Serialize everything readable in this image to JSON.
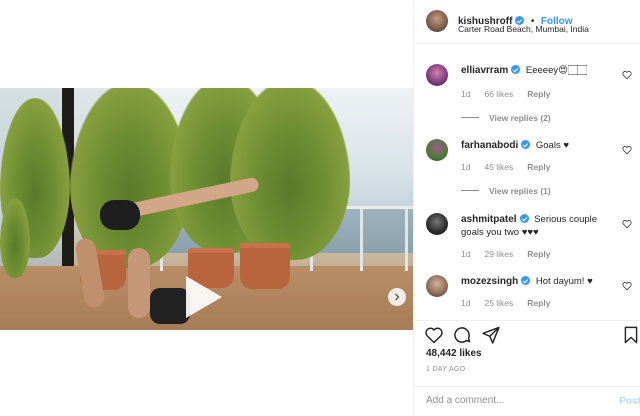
{
  "post": {
    "author": "kishushroff",
    "dot": "•",
    "follow_label": "Follow",
    "location": "Carter Road Beach, Mumbai, India",
    "likes": "48,442 likes",
    "timestamp": "1 DAY AGO",
    "add_comment_placeholder": "Add a comment...",
    "post_label": "Post"
  },
  "comments": [
    {
      "user": "elliavrram",
      "text": "Eeeeey😍🏻🏻",
      "age": "1d",
      "likes": "66 likes",
      "reply": "Reply",
      "view_replies": "View replies (2)"
    },
    {
      "user": "farhanabodi",
      "text": "Goals ♥",
      "age": "1d",
      "likes": "45 likes",
      "reply": "Reply",
      "view_replies": "View replies (1)"
    },
    {
      "user": "ashmitpatel",
      "text": "Serious couple goals you two ♥♥♥",
      "age": "1d",
      "likes": "29 likes",
      "reply": "Reply"
    },
    {
      "user": "mozezsingh",
      "text": "Hot dayum! ♥",
      "age": "1d",
      "likes": "25 likes",
      "reply": "Reply"
    }
  ],
  "icons": {
    "play": "play-icon",
    "next": "chevron-right-icon",
    "like": "heart-icon",
    "comment": "comment-icon",
    "share": "send-icon",
    "save": "bookmark-icon"
  },
  "colors": {
    "accent": "#3897f0",
    "muted": "#8e8e8e",
    "text": "#262626"
  }
}
